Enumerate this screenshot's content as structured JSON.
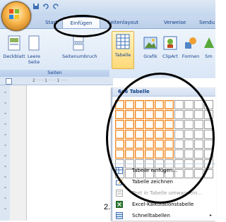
{
  "tabs": {
    "start": "Start",
    "einfuegen": "Einfügen",
    "seitenlayout": "Seitenlayout",
    "verweise": "Verweise",
    "sendungen": "Sendu"
  },
  "ribbon": {
    "deckblatt": "Deckblatt",
    "leere_seite": "Leere Seite",
    "seitenumbruch": "Seitenumbruch",
    "seiten_group": "Seiten",
    "tabelle": "Tabelle",
    "grafik": "Grafik",
    "clipart": "ClipArt",
    "formen": "Formen",
    "smartart": "Sm"
  },
  "ruler": {
    "marks": "2 · · · 1 · · · 1 · · ·"
  },
  "dropdown": {
    "header": "6x6 Tabelle",
    "grid": {
      "columns": 10,
      "rows": 8,
      "selected_columns": 6,
      "selected_rows": 6
    },
    "items": [
      {
        "label": "Tabelle einfügen...",
        "icon": "table-insert-icon",
        "enabled": true
      },
      {
        "label": "Tabelle zeichnen",
        "icon": "pencil-icon",
        "enabled": true
      },
      {
        "label": "Text in Tabelle umwandeln...",
        "icon": "text-to-table-icon",
        "enabled": false
      },
      {
        "label": "Excel-Kalkulationstabelle",
        "icon": "excel-icon",
        "enabled": true
      },
      {
        "label": "Schnelltabellen",
        "icon": "quick-tables-icon",
        "enabled": true
      }
    ]
  },
  "annotation": {
    "step": "2."
  },
  "colors": {
    "selection": "#f0841f",
    "ribbon_text": "#15428b"
  }
}
